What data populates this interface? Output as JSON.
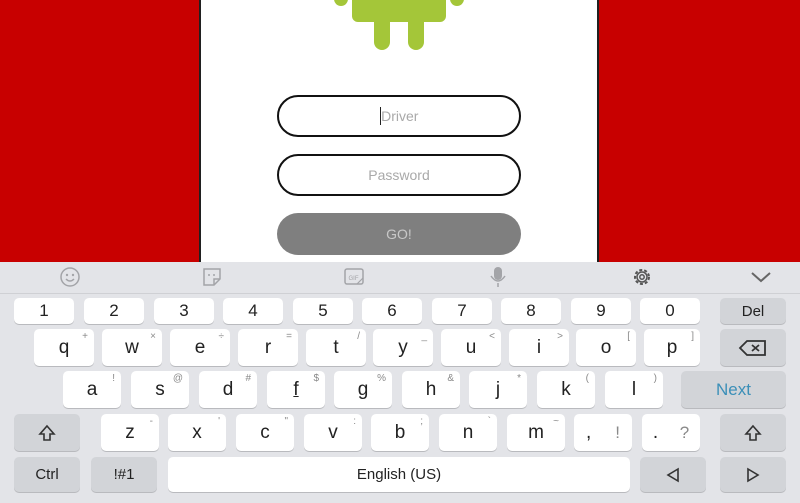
{
  "app": {
    "driver_placeholder": "Driver",
    "password_placeholder": "Password",
    "go_label": "GO!",
    "colors": {
      "background": "#c80000",
      "logo": "#a4c639",
      "button": "#7f7f7f"
    }
  },
  "keyboard": {
    "toolbar": [
      "emoji-icon",
      "sticker-icon",
      "gif-icon",
      "microphone-icon",
      "settings-icon",
      "collapse-chevron-icon"
    ],
    "number_row": [
      "1",
      "2",
      "3",
      "4",
      "5",
      "6",
      "7",
      "8",
      "9",
      "0"
    ],
    "del_label": "Del",
    "row1": [
      {
        "k": "q",
        "s": "+"
      },
      {
        "k": "w",
        "s": "×"
      },
      {
        "k": "e",
        "s": "÷"
      },
      {
        "k": "r",
        "s": "="
      },
      {
        "k": "t",
        "s": "/"
      },
      {
        "k": "y",
        "s": "_"
      },
      {
        "k": "u",
        "s": "<"
      },
      {
        "k": "i",
        "s": ">"
      },
      {
        "k": "o",
        "s": "["
      },
      {
        "k": "p",
        "s": "]"
      }
    ],
    "row2": [
      {
        "k": "a",
        "s": "!"
      },
      {
        "k": "s",
        "s": "@"
      },
      {
        "k": "d",
        "s": "#"
      },
      {
        "k": "f",
        "s": "$"
      },
      {
        "k": "g",
        "s": "%"
      },
      {
        "k": "h",
        "s": "&"
      },
      {
        "k": "j",
        "s": "*"
      },
      {
        "k": "k",
        "s": "("
      },
      {
        "k": "l",
        "s": ")"
      }
    ],
    "next_label": "Next",
    "row3": [
      {
        "k": "z",
        "s": "-"
      },
      {
        "k": "x",
        "s": "'"
      },
      {
        "k": "c",
        "s": "\""
      },
      {
        "k": "v",
        "s": ":"
      },
      {
        "k": "b",
        "s": ";"
      },
      {
        "k": "n",
        "s": "`"
      },
      {
        "k": "m",
        "s": "~"
      }
    ],
    "comma_label": ",",
    "comma_alt": "!",
    "period_label": ".",
    "period_alt": "?",
    "ctrl_label": "Ctrl",
    "symbols_label": "!#1",
    "space_label": "English (US)"
  }
}
